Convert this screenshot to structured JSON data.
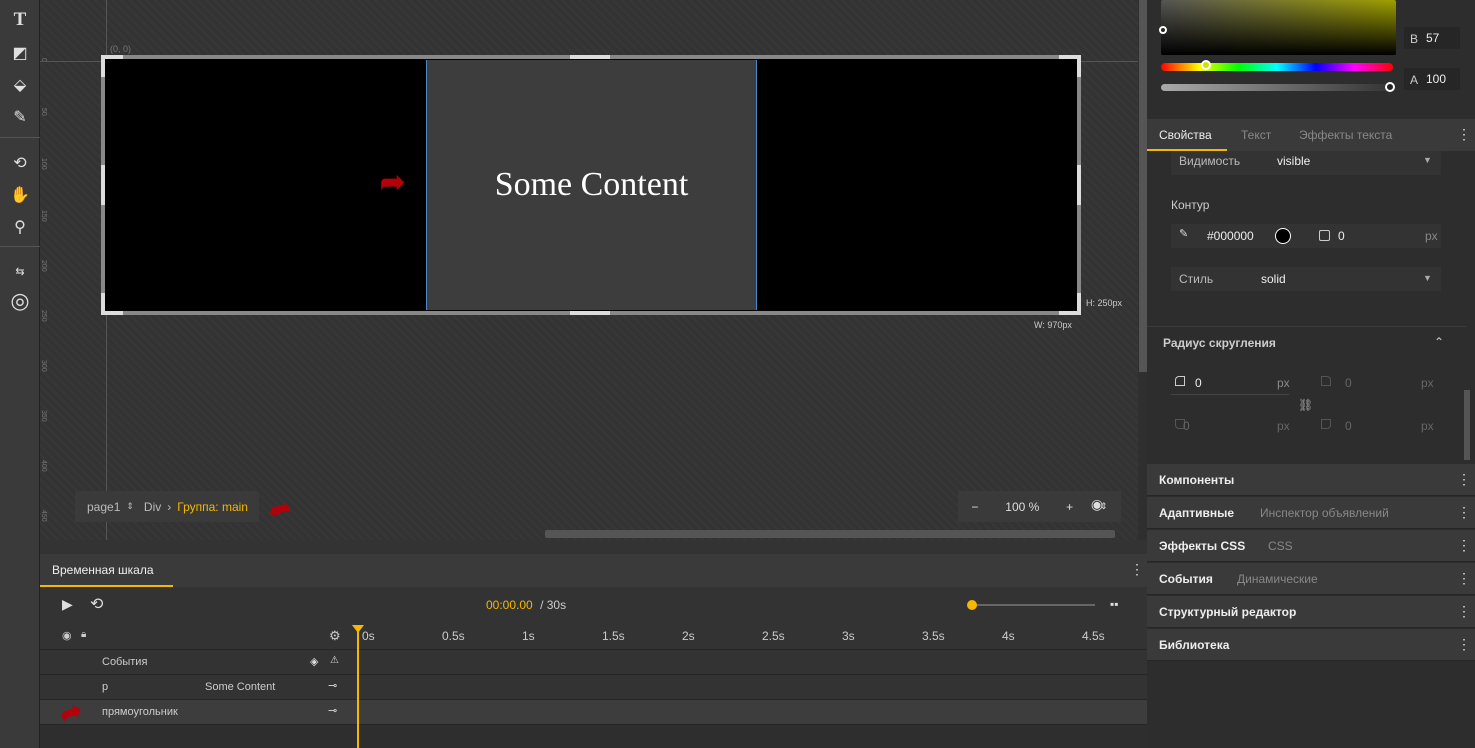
{
  "toolbar": {
    "tools": [
      {
        "name": "text-tool-icon",
        "glyph": "T"
      },
      {
        "name": "shape-tool-icon",
        "glyph": "◩"
      },
      {
        "name": "fill-tool-icon",
        "glyph": "⬙"
      },
      {
        "name": "eyedropper-icon",
        "glyph": "✎"
      },
      {
        "name": "transform-tool-icon",
        "glyph": "⟲"
      },
      {
        "name": "hand-tool-icon",
        "glyph": "✋"
      },
      {
        "name": "zoom-tool-icon",
        "glyph": "⚲"
      },
      {
        "name": "swap-colors-icon",
        "glyph": "⇆"
      },
      {
        "name": "fill-stroke-icon",
        "glyph": "◎"
      }
    ]
  },
  "canvas": {
    "origin_label": "(0, 0)",
    "ruler_numbers": [
      "0",
      "50",
      "100",
      "150",
      "200",
      "250",
      "300",
      "350",
      "400",
      "450"
    ],
    "content_text": "Some Content",
    "height_label": "H: 250px",
    "width_label": "W: 970px",
    "breadcrumb": {
      "page": "page1",
      "element": "Div",
      "group": "Группа: main"
    },
    "zoom": {
      "minus": "−",
      "value": "100",
      "unit": "%",
      "plus": "+"
    }
  },
  "timeline": {
    "tab_label": "Временная шкала",
    "current_time": "00:00.00",
    "total_time": "/ 30s",
    "ticks": [
      "0s",
      "0.5s",
      "1s",
      "1.5s",
      "2s",
      "2.5s",
      "3s",
      "3.5s",
      "4s",
      "4.5s"
    ],
    "rows": [
      {
        "label": "События",
        "value": ""
      },
      {
        "label": "p",
        "value": "Some Content"
      },
      {
        "label": "прямоугольник",
        "value": ""
      }
    ]
  },
  "panel": {
    "color": {
      "b_label": "B",
      "b_value": "57",
      "a_label": "A",
      "a_value": "100"
    },
    "tabs": [
      "Свойства",
      "Текст",
      "Эффекты текста"
    ],
    "visibility": {
      "label": "Видимость",
      "value": "visible"
    },
    "outline": {
      "title": "Контур",
      "color": "#000000",
      "width": "0",
      "unit": "px"
    },
    "style": {
      "label": "Стиль",
      "value": "solid"
    },
    "radius": {
      "title": "Радиус скругления",
      "tl": "0",
      "tr": "0",
      "bl": "0",
      "br": "0",
      "unit": "px"
    },
    "sections": [
      {
        "title": "Компоненты",
        "sub": ""
      },
      {
        "title": "Адаптивные",
        "sub": "Инспектор объявлений"
      },
      {
        "title": "Эффекты CSS",
        "sub": "CSS"
      },
      {
        "title": "События",
        "sub": "Динамические"
      },
      {
        "title": "Структурный редактор",
        "sub": ""
      },
      {
        "title": "Библиотека",
        "sub": ""
      }
    ]
  },
  "colors": {
    "accent": "#f5b800",
    "guide": "#4c88c8",
    "arrow": "#b3000a"
  }
}
